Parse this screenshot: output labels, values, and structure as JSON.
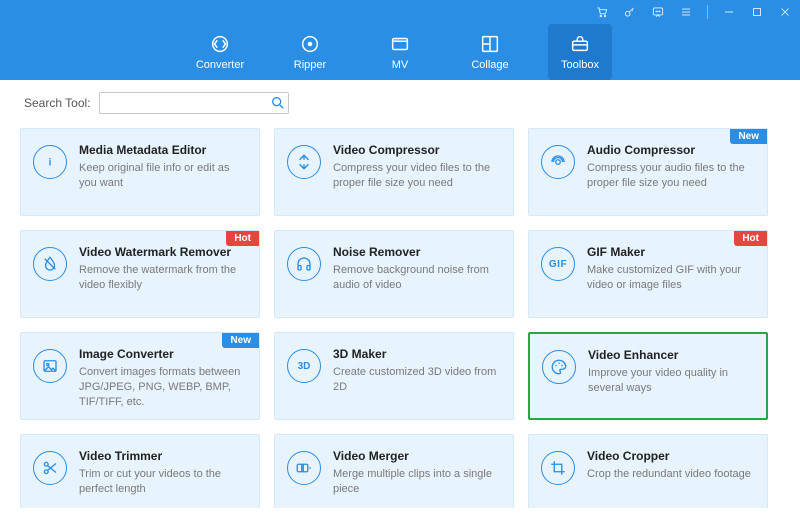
{
  "titlebar": {
    "icons": [
      "cart",
      "key",
      "feedback",
      "menu",
      "minimize",
      "maximize",
      "close"
    ]
  },
  "nav": {
    "items": [
      {
        "id": "converter",
        "label": "Converter",
        "icon": "converter"
      },
      {
        "id": "ripper",
        "label": "Ripper",
        "icon": "ripper"
      },
      {
        "id": "mv",
        "label": "MV",
        "icon": "mv"
      },
      {
        "id": "collage",
        "label": "Collage",
        "icon": "collage"
      },
      {
        "id": "toolbox",
        "label": "Toolbox",
        "icon": "toolbox",
        "active": true
      }
    ]
  },
  "search": {
    "label": "Search Tool:",
    "value": "",
    "placeholder": ""
  },
  "badges": {
    "hot": "Hot",
    "new": "New"
  },
  "highlighted_tool_id": "video-enhancer",
  "tools": [
    {
      "id": "media-metadata-editor",
      "title": "Media Metadata Editor",
      "desc": "Keep original file info or edit as you want",
      "icon": "info",
      "badge": null
    },
    {
      "id": "video-compressor",
      "title": "Video Compressor",
      "desc": "Compress your video files to the proper file size you need",
      "icon": "compress",
      "badge": null
    },
    {
      "id": "audio-compressor",
      "title": "Audio Compressor",
      "desc": "Compress your audio files to the proper file size you need",
      "icon": "audio-compress",
      "badge": "new"
    },
    {
      "id": "video-watermark-remover",
      "title": "Video Watermark Remover",
      "desc": "Remove the watermark from the video flexibly",
      "icon": "droplet",
      "badge": "hot"
    },
    {
      "id": "noise-remover",
      "title": "Noise Remover",
      "desc": "Remove background noise from audio of video",
      "icon": "headphones",
      "badge": null
    },
    {
      "id": "gif-maker",
      "title": "GIF Maker",
      "desc": "Make customized GIF with your video or image files",
      "icon": "gif",
      "badge": "hot"
    },
    {
      "id": "image-converter",
      "title": "Image Converter",
      "desc": "Convert images formats between JPG/JPEG, PNG, WEBP, BMP, TIF/TIFF, etc.",
      "icon": "image",
      "badge": "new"
    },
    {
      "id": "3d-maker",
      "title": "3D Maker",
      "desc": "Create customized 3D video from 2D",
      "icon": "3d",
      "badge": null
    },
    {
      "id": "video-enhancer",
      "title": "Video Enhancer",
      "desc": "Improve your video quality in several ways",
      "icon": "palette",
      "badge": null
    },
    {
      "id": "video-trimmer",
      "title": "Video Trimmer",
      "desc": "Trim or cut your videos to the perfect length",
      "icon": "scissors",
      "badge": null
    },
    {
      "id": "video-merger",
      "title": "Video Merger",
      "desc": "Merge multiple clips into a single piece",
      "icon": "merge",
      "badge": null
    },
    {
      "id": "video-cropper",
      "title": "Video Cropper",
      "desc": "Crop the redundant video footage",
      "icon": "crop",
      "badge": null
    }
  ]
}
